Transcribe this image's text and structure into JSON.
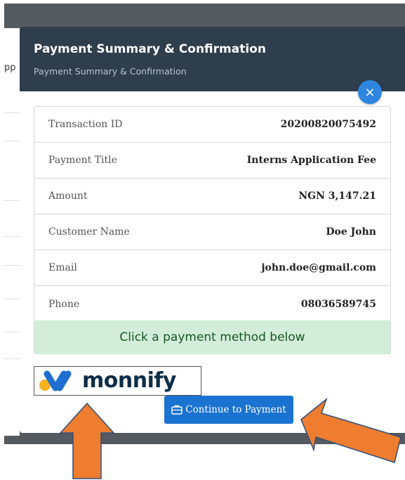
{
  "backdrop": {
    "fragment": "pp"
  },
  "modal": {
    "title": "Payment Summary & Confirmation",
    "subtitle": "Payment Summary & Confirmation",
    "close_label": "×"
  },
  "details": [
    {
      "label": "Transaction ID",
      "value": "20200820075492"
    },
    {
      "label": "Payment Title",
      "value": "Interns Application Fee"
    },
    {
      "label": "Amount",
      "value": "NGN 3,147.21"
    },
    {
      "label": "Customer Name",
      "value": "Doe John"
    },
    {
      "label": "Email",
      "value": "john.doe@gmail.com"
    },
    {
      "label": "Phone",
      "value": "08036589745"
    }
  ],
  "info": {
    "text": "Click a payment method below"
  },
  "payment_method": {
    "brand": "monnify"
  },
  "actions": {
    "continue_label": "Continue to Payment"
  },
  "colors": {
    "header": "#2f3e4d",
    "close": "#2f86e0",
    "info_bg": "#d4edda",
    "info_text": "#155724",
    "button": "#1a73d0",
    "arrow": "#ee7d30",
    "monnify_yellow": "#f5b322",
    "monnify_blue": "#1f6fd1"
  }
}
